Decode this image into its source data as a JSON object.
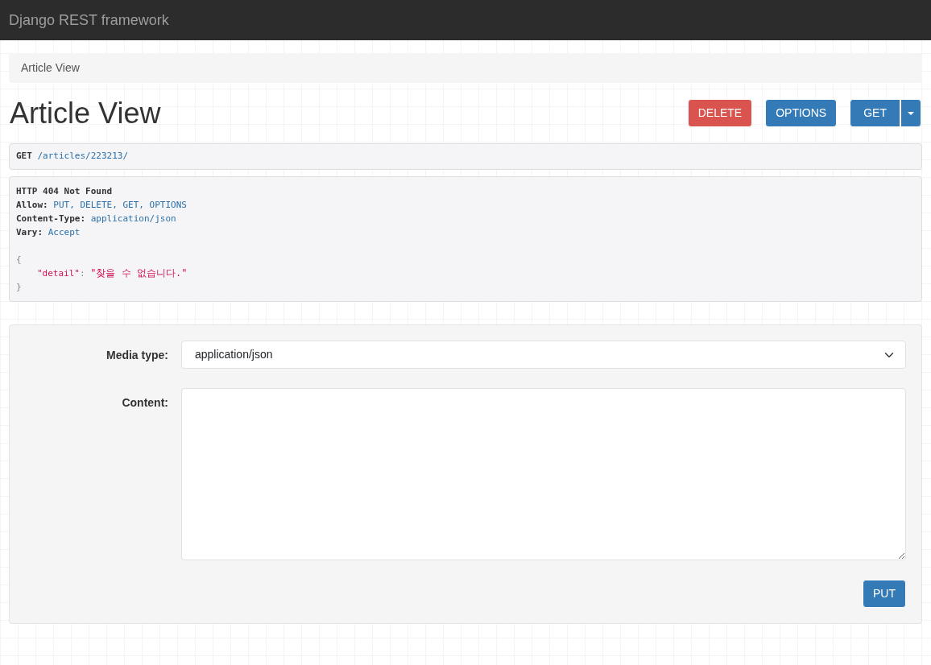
{
  "navbar": {
    "brand": "Django REST framework"
  },
  "breadcrumb": [
    {
      "label": "Article View",
      "selected": true
    }
  ],
  "page_title": "Article View",
  "actions": [
    {
      "label": "DELETE",
      "kind": "danger"
    },
    {
      "label": "OPTIONS",
      "kind": "primary"
    },
    {
      "label": "GET",
      "kind": "split"
    }
  ],
  "request": {
    "method": "GET",
    "path": "/articles/223213/"
  },
  "response": {
    "status": "HTTP 404 Not Found",
    "headers": [
      {
        "name": "Allow:",
        "value": "PUT, DELETE, GET, OPTIONS"
      },
      {
        "name": "Content-Type:",
        "value": "application/json"
      },
      {
        "name": "Vary:",
        "value": "Accept"
      }
    ],
    "body": {
      "open": "{",
      "entries": [
        {
          "key": "\"detail\"",
          "separator": ":",
          "value": "\"찾을 수 없습니다.\""
        }
      ],
      "close": "}"
    }
  },
  "form": {
    "fields": [
      {
        "label": "Media type:",
        "kind": "select",
        "value": "application/json"
      },
      {
        "label": "Content:",
        "kind": "textarea"
      }
    ],
    "submit": "PUT"
  }
}
